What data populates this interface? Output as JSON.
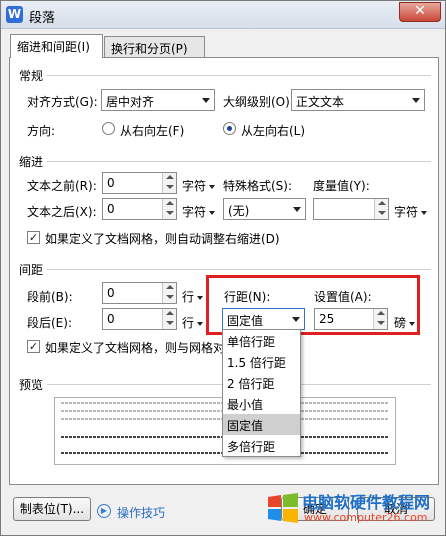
{
  "window": {
    "title": "段落",
    "close_glyph": "✕"
  },
  "tabs": [
    {
      "label": "缩进和间距(I)",
      "active": true
    },
    {
      "label": "换行和分页(P)",
      "active": false
    }
  ],
  "general": {
    "group_label": "常规",
    "alignment_label": "对齐方式(G):",
    "alignment_value": "居中对齐",
    "outline_label": "大纲级别(O):",
    "outline_value": "正文文本",
    "direction_label": "方向:",
    "rtl_label": "从右向左(F)",
    "ltr_label": "从左向右(L)"
  },
  "indent": {
    "group_label": "缩进",
    "before_label": "文本之前(R):",
    "before_value": "0",
    "before_unit": "字符",
    "after_label": "文本之后(X):",
    "after_value": "0",
    "after_unit": "字符",
    "special_label": "特殊格式(S):",
    "special_value": "(无)",
    "measure_label": "度量值(Y):",
    "measure_value": "",
    "measure_unit": "字符",
    "grid_checkbox": "如果定义了文档网格，则自动调整右缩进(D)"
  },
  "spacing": {
    "group_label": "间距",
    "before_label": "段前(B):",
    "before_value": "0",
    "before_unit": "行",
    "after_label": "段后(E):",
    "after_value": "0",
    "after_unit": "行",
    "line_label": "行距(N):",
    "line_value": "固定值",
    "setting_label": "设置值(A):",
    "setting_value": "25",
    "setting_unit": "磅",
    "grid_checkbox": "如果定义了文档网格，则与网格对"
  },
  "line_spacing_options": [
    "单倍行距",
    "1.5 倍行距",
    "2 倍行距",
    "最小值",
    "固定值",
    "多倍行距"
  ],
  "line_spacing_selected_index": 4,
  "preview": {
    "group_label": "预览"
  },
  "footer": {
    "tabs_button": "制表位(T)...",
    "tips_link": "操作技巧",
    "ok_button": "确定",
    "cancel_button": "取消"
  },
  "watermark": {
    "title": "电脑软硬件教程网",
    "url": "www.computer26.com"
  },
  "colors": {
    "highlight_border": "#e02020",
    "selected_option": "#cfcfcf",
    "watermark_blue": "#1f6fc7"
  }
}
